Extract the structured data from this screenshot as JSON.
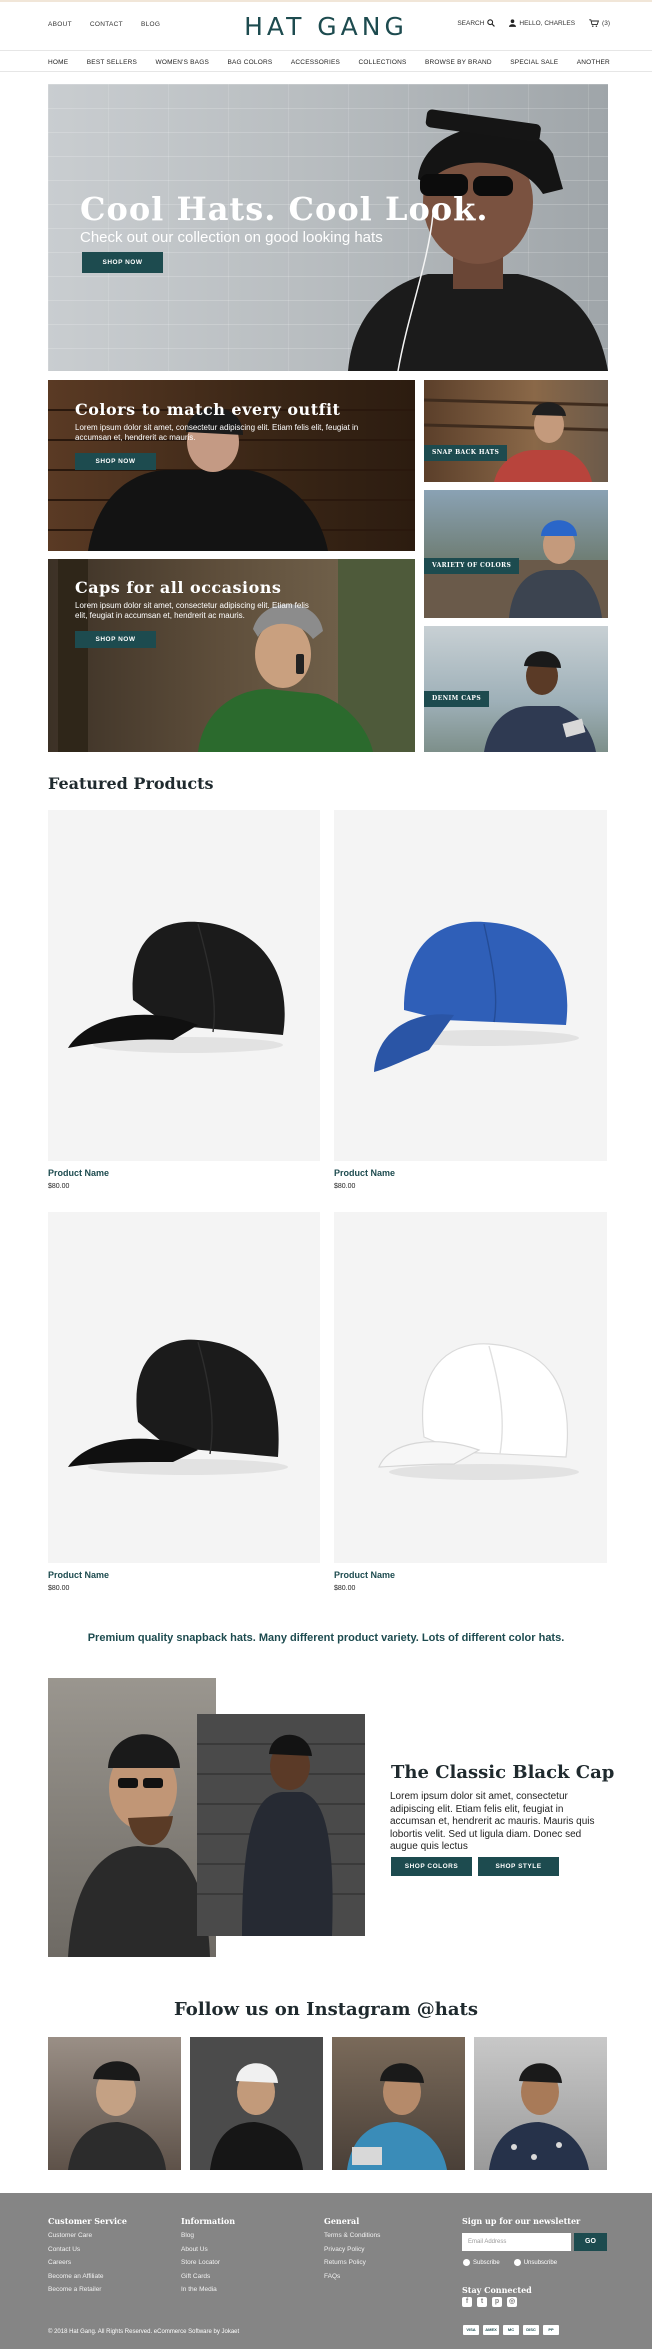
{
  "header": {
    "util_nav": [
      "ABOUT",
      "CONTACT",
      "BLOG"
    ],
    "logo": "HAT GANG",
    "search_label": "SEARCH",
    "greeting": "HELLO, CHARLES",
    "cart_count": "(3)"
  },
  "main_nav": [
    "HOME",
    "BEST SELLERS",
    "WOMEN'S BAGS",
    "BAG COLORS",
    "ACCESSORIES",
    "COLLECTIONS",
    "BROWSE BY BRAND",
    "SPECIAL SALE",
    "ANOTHER"
  ],
  "hero": {
    "title": "Cool Hats. Cool Look.",
    "subtitle": "Check out our collection on good looking hats",
    "cta": "SHOP NOW"
  },
  "promos": [
    {
      "title": "Colors to match every outfit",
      "body": "Lorem ipsum dolor sit amet, consectetur adipiscing elit. Etiam felis elit, feugiat in accumsan et, hendrerit ac mauris.",
      "cta": "SHOP NOW"
    },
    {
      "title": "Caps for all occasions",
      "body": "Lorem ipsum dolor sit amet, consectetur adipiscing elit. Etiam felis elit, feugiat in accumsan et, hendrerit ac mauris.",
      "cta": "SHOP NOW"
    }
  ],
  "side_tiles": [
    "SNAP BACK HATS",
    "VARIETY OF COLORS",
    "DENIM CAPS"
  ],
  "featured": {
    "title": "Featured Products",
    "products": [
      {
        "name": "Product Name",
        "price": "$80.00",
        "color": "#1a1a1a"
      },
      {
        "name": "Product Name",
        "price": "$80.00",
        "color": "#2f5fb8"
      },
      {
        "name": "Product Name",
        "price": "$80.00",
        "color": "#1a1a1a"
      },
      {
        "name": "Product Name",
        "price": "$80.00",
        "color": "#f2f2f2"
      }
    ]
  },
  "tagline": "Premium quality snapback hats. Many different product variety. Lots of different color hats.",
  "classic": {
    "title": "The Classic Black Cap",
    "body": "Lorem ipsum dolor sit amet, consectetur adipiscing elit. Etiam felis elit, feugiat in accumsan et, hendrerit ac mauris. Mauris quis lobortis velit. Sed ut ligula diam. Donec sed augue quis lectus",
    "buttons": [
      "SHOP COLORS",
      "SHOP STYLE"
    ]
  },
  "instagram": {
    "title": "Follow us on Instagram @hats"
  },
  "footer": {
    "columns": [
      {
        "title": "Customer Service",
        "links": [
          "Customer Care",
          "Contact Us",
          "Careers",
          "Become an Affiliate",
          "Become a Retailer"
        ]
      },
      {
        "title": "Information",
        "links": [
          "Blog",
          "About Us",
          "Store Locator",
          "Gift Cards",
          "In the Media"
        ]
      },
      {
        "title": "General",
        "links": [
          "Terms & Conditions",
          "Privacy Policy",
          "Returns Policy",
          "FAQs"
        ]
      }
    ],
    "newsletter_title": "Sign up for our newsletter",
    "email_placeholder": "Email Address",
    "go": "GO",
    "subscribe": "Subscribe",
    "unsubscribe": "Unsubscribe",
    "stay_connected": "Stay Connected",
    "copyright": "© 2018 Hat Gang. All Rights Reserved. eCommerce Software by Jokaet",
    "payments": [
      "VISA",
      "AMEX",
      "MC",
      "DISC",
      "PP"
    ]
  },
  "colors": {
    "brand": "#1d4b4f",
    "footer_bg": "#858585"
  }
}
